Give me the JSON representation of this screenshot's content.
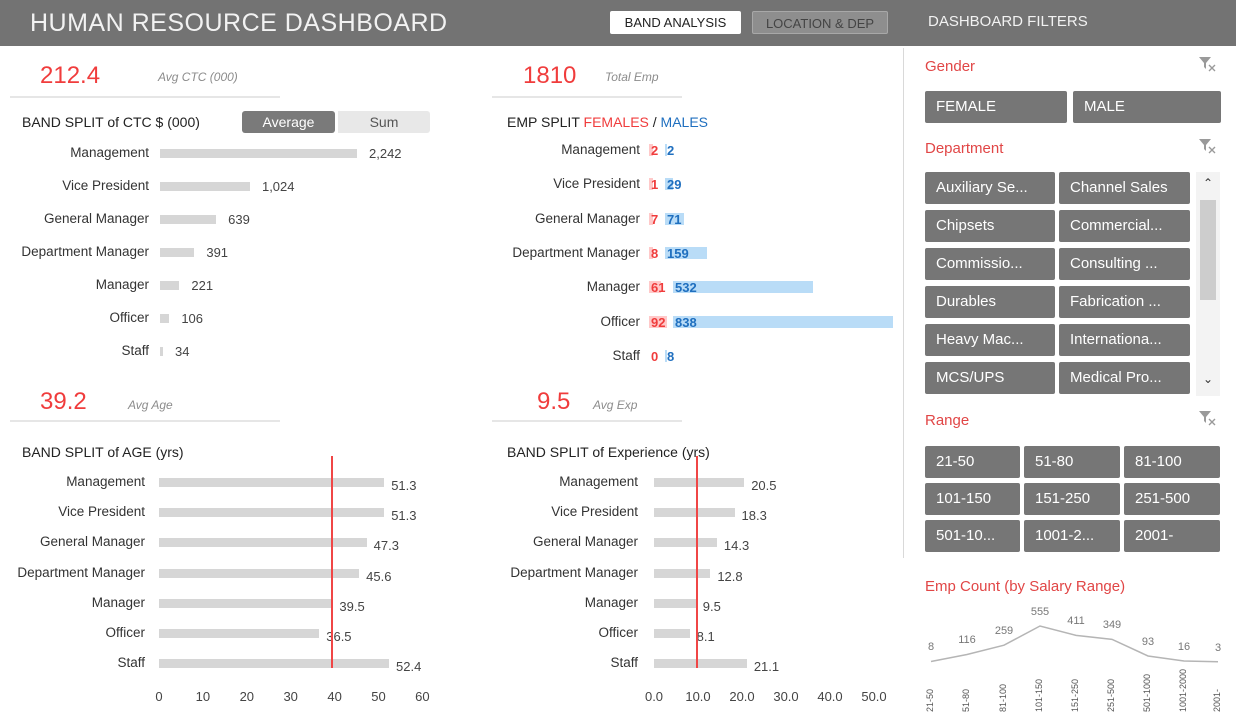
{
  "header": {
    "title": "HUMAN RESOURCE DASHBOARD",
    "tabs": [
      "BAND ANALYSIS",
      "LOCATION & DEP"
    ],
    "filters_title": "DASHBOARD FILTERS"
  },
  "kpis": {
    "ctc": {
      "value": "212.4",
      "label": "Avg CTC (000)"
    },
    "emp": {
      "value": "1810",
      "label": "Total Emp"
    },
    "age": {
      "value": "39.2",
      "label": "Avg Age"
    },
    "exp": {
      "value": "9.5",
      "label": "Avg Exp"
    }
  },
  "toggle": {
    "average": "Average",
    "sum": "Sum"
  },
  "emp_title": {
    "prefix": "EMP SPLIT ",
    "females": "FEMALES",
    "sep": " / ",
    "males": "MALES"
  },
  "filters": {
    "gender": {
      "title": "Gender",
      "items": [
        "FEMALE",
        "MALE"
      ]
    },
    "department": {
      "title": "Department",
      "items": [
        "Auxiliary Se...",
        "Channel Sales",
        "Chipsets",
        "Commercial...",
        "Commissio...",
        "Consulting ...",
        "Durables",
        "Fabrication ...",
        "Heavy Mac...",
        "Internationa...",
        "MCS/UPS",
        "Medical Pro..."
      ]
    },
    "range": {
      "title": "Range",
      "items": [
        "21-50",
        "51-80",
        "81-100",
        "101-150",
        "151-250",
        "251-500",
        "501-10...",
        "1001-2...",
        "2001-"
      ]
    }
  },
  "chart_data": [
    {
      "type": "bar",
      "title": "BAND SPLIT of CTC $ (000)",
      "categories": [
        "Management",
        "Vice President",
        "General Manager",
        "Department Manager",
        "Manager",
        "Officer",
        "Staff"
      ],
      "values": [
        2242,
        1024,
        639,
        391,
        221,
        106,
        34
      ],
      "value_labels": [
        "2,242",
        "1,024",
        "639",
        "391",
        "221",
        "106",
        "34"
      ]
    },
    {
      "type": "bar",
      "title": "EMP SPLIT FEMALES / MALES",
      "categories": [
        "Management",
        "Vice President",
        "General Manager",
        "Department Manager",
        "Manager",
        "Officer",
        "Staff"
      ],
      "series": [
        {
          "name": "FEMALES",
          "values": [
            2,
            1,
            7,
            8,
            61,
            92,
            0
          ]
        },
        {
          "name": "MALES",
          "values": [
            2,
            29,
            71,
            159,
            532,
            838,
            8
          ]
        }
      ]
    },
    {
      "type": "bar",
      "title": "BAND SPLIT of AGE (yrs)",
      "categories": [
        "Management",
        "Vice President",
        "General Manager",
        "Department Manager",
        "Manager",
        "Officer",
        "Staff"
      ],
      "values": [
        51.3,
        51.3,
        47.3,
        45.6,
        39.5,
        36.5,
        52.4
      ],
      "xlim": [
        0,
        60
      ],
      "xticks": [
        "0",
        "10",
        "20",
        "30",
        "40",
        "50",
        "60"
      ],
      "reference_line": 39.2
    },
    {
      "type": "bar",
      "title": "BAND SPLIT of Experience (yrs)",
      "categories": [
        "Management",
        "Vice President",
        "General Manager",
        "Department Manager",
        "Manager",
        "Officer",
        "Staff"
      ],
      "values": [
        20.5,
        18.3,
        14.3,
        12.8,
        9.5,
        8.1,
        21.1
      ],
      "xlim": [
        0,
        50
      ],
      "xticks": [
        "0.0",
        "10.0",
        "20.0",
        "30.0",
        "40.0",
        "50.0"
      ],
      "reference_line": 9.5
    },
    {
      "type": "line",
      "title": "Emp Count (by Salary Range)",
      "categories": [
        "21-50",
        "51-80",
        "81-100",
        "101-150",
        "151-250",
        "251-500",
        "501-1000",
        "1001-2000",
        "2001-"
      ],
      "values": [
        8,
        116,
        259,
        555,
        411,
        349,
        93,
        16,
        3
      ]
    }
  ],
  "colors": {
    "accent_red": "#f03c3c",
    "male_blue": "#1f6fbf",
    "female_bar": "#ffc9c9",
    "male_bar": "#b9dcf7",
    "bar_gray": "#d6d6d6",
    "chip_gray": "#767676",
    "header_gray": "#737373"
  },
  "icons": {
    "filter_clear": "filter-clear-icon",
    "scroll_up": "chevron-up-icon",
    "scroll_down": "chevron-down-icon"
  }
}
